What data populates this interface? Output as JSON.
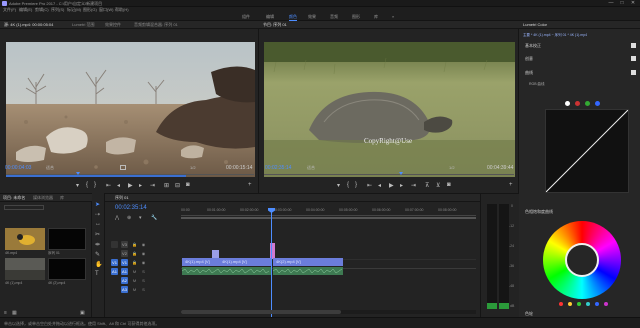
{
  "app": {
    "title": "Adobe Premiere Pro 2017 - C:\\用户\\自定义\\新建项目",
    "window_controls": {
      "minimize": "—",
      "maximize": "□",
      "close": "✕"
    },
    "menus": [
      "文件(F)",
      "编辑(E)",
      "剪辑(C)",
      "序列(S)",
      "标记(M)",
      "图形(G)",
      "窗口(W)",
      "帮助(H)"
    ]
  },
  "workspaces": [
    "组件",
    "编辑",
    "颜色",
    "效果",
    "音频",
    "图形",
    "库",
    "»"
  ],
  "source_monitor": {
    "tabs": [
      "源: 4K (1).mp4: 00:00:05:04",
      "Lumetri 范围",
      "效果控件",
      "音频剪辑混合器: 序列 01"
    ],
    "timecode": "00:00:04:03",
    "fit": "适合",
    "duration": "00:00:15:14",
    "scale": "1/2"
  },
  "program_monitor": {
    "tabs": [
      "节目: 序列 01"
    ],
    "overlay_text": "CopyRight@Use",
    "timecode": "00:02:35:14",
    "fit": "适合",
    "duration": "00:04:39:44",
    "scale": "1/2"
  },
  "project_panel": {
    "tabs": [
      "项目: 未命名",
      "媒体浏览器",
      "库",
      "信息",
      "效果"
    ],
    "items": [
      {
        "name": "4K.mp4",
        "duration": "15:14"
      },
      {
        "name": "序列 01",
        "duration": "4:39:44"
      },
      {
        "name": "4K (1).mp4",
        "duration": "15:14"
      },
      {
        "name": "4K (2).mp4",
        "duration": "15:14"
      }
    ]
  },
  "timeline": {
    "tab": "序列 01",
    "timecode": "00:02:35:14",
    "ruler": [
      "00:00",
      "00:01:00:00",
      "00:02:00:00",
      "00:03:00:00",
      "00:04:00:00",
      "00:05:00:00",
      "00:06:00:00",
      "00:07:00:00",
      "00:08:00:00"
    ],
    "tracks": [
      "V3",
      "V2",
      "V1",
      "A1",
      "A2",
      "A3"
    ],
    "clips": [
      {
        "label": "4K(1).mp4 [V]"
      },
      {
        "label": "4K(1).mp4 [V]"
      },
      {
        "label": "4K(2).mp4 [V]"
      }
    ]
  },
  "lumetri": {
    "title": "Lumetri Color",
    "source_dropdown": "主要 * 4K (1).mp4 ~ 序列 01 * 4K (1).mp4",
    "sections": [
      "基本校正",
      "创意",
      "曲线",
      "RGB 曲线",
      "色相饱和度曲线",
      "色轮",
      "晕影"
    ],
    "curve_colors": [
      "#ffffff",
      "#ff3333",
      "#33cc33",
      "#3366ff"
    ],
    "hsl_label": "色相饱和度曲线"
  },
  "audio_meter": {
    "labels": [
      "0",
      "-12",
      "-24",
      "-36",
      "-48",
      "dB"
    ]
  },
  "statusbar": {
    "text": "单击以选择，或单击空白处并拖动以进行框选。使用 Shift、Alt 和 Ctrl 可获得其他选项。"
  }
}
